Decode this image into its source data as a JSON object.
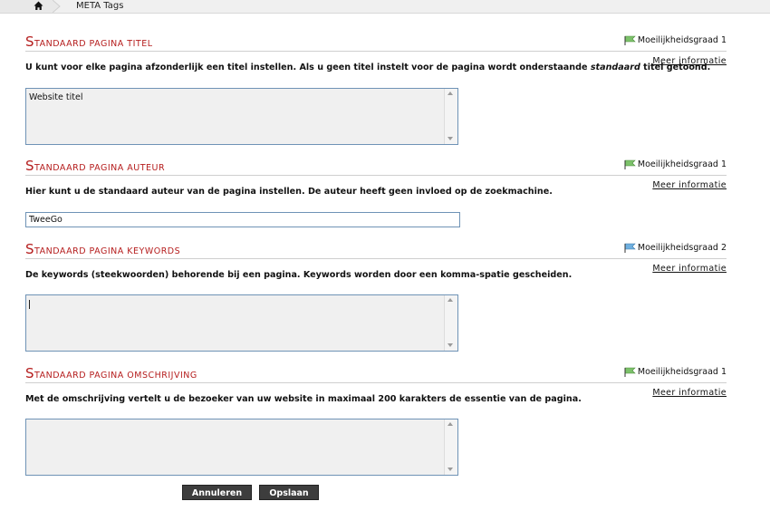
{
  "breadcrumb": {
    "home_icon": "home-icon",
    "current": "META Tags"
  },
  "sections": [
    {
      "title_first": "S",
      "title_rest": "tandaard pagina titel",
      "difficulty": "Moeilijkheidsgraad 1",
      "more": "Meer informatie",
      "desc_before": "U kunt voor elke pagina afzonderlijk een titel instellen. Als u geen titel instelt voor de pagina wordt onderstaande ",
      "desc_em": "standaard",
      "desc_after": " titel getoond.",
      "value": "Website titel",
      "flag_color": "#7cc26a"
    },
    {
      "title_first": "S",
      "title_rest": "tandaard pagina auteur",
      "difficulty": "Moeilijkheidsgraad 1",
      "more": "Meer informatie",
      "desc": "Hier kunt u de standaard auteur van de pagina instellen. De auteur heeft geen invloed op de zoekmachine.",
      "value": "TweeGo",
      "flag_color": "#7cc26a"
    },
    {
      "title_first": "S",
      "title_rest": "tandaard pagina keywords",
      "difficulty": "Moeilijkheidsgraad 2",
      "more": "Meer informatie",
      "desc": "De keywords (steekwoorden) behorende bij een pagina. Keywords worden door een komma-spatie gescheiden.",
      "value": "",
      "flag_color": "#6fb0e0"
    },
    {
      "title_first": "S",
      "title_rest": "tandaard pagina omschrijving",
      "difficulty": "Moeilijkheidsgraad 1",
      "more": "Meer informatie",
      "desc": "Met de omschrijving vertelt u de bezoeker van uw website in maximaal 200 karakters de essentie van de pagina.",
      "value": "",
      "flag_color": "#7cc26a"
    }
  ],
  "buttons": {
    "cancel": "Annuleren",
    "save": "Opslaan"
  },
  "colors": {
    "accent": "#b51d1d",
    "field_border": "#6f93b6",
    "button": "#3d3d3d"
  }
}
